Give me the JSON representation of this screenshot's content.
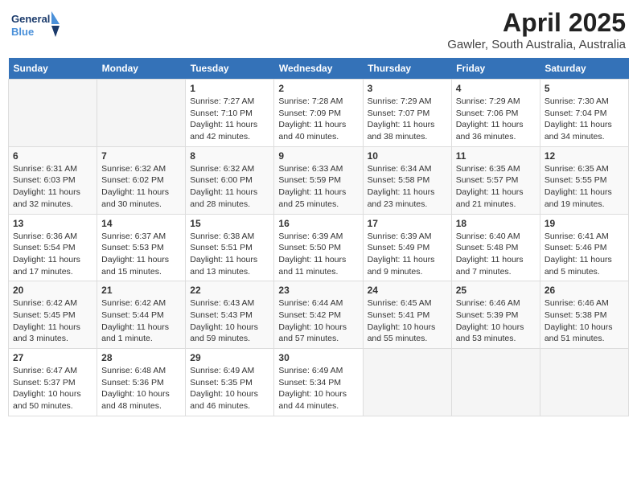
{
  "header": {
    "logo_general": "General",
    "logo_blue": "Blue",
    "month_title": "April 2025",
    "location": "Gawler, South Australia, Australia"
  },
  "days_of_week": [
    "Sunday",
    "Monday",
    "Tuesday",
    "Wednesday",
    "Thursday",
    "Friday",
    "Saturday"
  ],
  "weeks": [
    [
      {
        "day": "",
        "info": ""
      },
      {
        "day": "",
        "info": ""
      },
      {
        "day": "1",
        "info": "Sunrise: 7:27 AM\nSunset: 7:10 PM\nDaylight: 11 hours and 42 minutes."
      },
      {
        "day": "2",
        "info": "Sunrise: 7:28 AM\nSunset: 7:09 PM\nDaylight: 11 hours and 40 minutes."
      },
      {
        "day": "3",
        "info": "Sunrise: 7:29 AM\nSunset: 7:07 PM\nDaylight: 11 hours and 38 minutes."
      },
      {
        "day": "4",
        "info": "Sunrise: 7:29 AM\nSunset: 7:06 PM\nDaylight: 11 hours and 36 minutes."
      },
      {
        "day": "5",
        "info": "Sunrise: 7:30 AM\nSunset: 7:04 PM\nDaylight: 11 hours and 34 minutes."
      }
    ],
    [
      {
        "day": "6",
        "info": "Sunrise: 6:31 AM\nSunset: 6:03 PM\nDaylight: 11 hours and 32 minutes."
      },
      {
        "day": "7",
        "info": "Sunrise: 6:32 AM\nSunset: 6:02 PM\nDaylight: 11 hours and 30 minutes."
      },
      {
        "day": "8",
        "info": "Sunrise: 6:32 AM\nSunset: 6:00 PM\nDaylight: 11 hours and 28 minutes."
      },
      {
        "day": "9",
        "info": "Sunrise: 6:33 AM\nSunset: 5:59 PM\nDaylight: 11 hours and 25 minutes."
      },
      {
        "day": "10",
        "info": "Sunrise: 6:34 AM\nSunset: 5:58 PM\nDaylight: 11 hours and 23 minutes."
      },
      {
        "day": "11",
        "info": "Sunrise: 6:35 AM\nSunset: 5:57 PM\nDaylight: 11 hours and 21 minutes."
      },
      {
        "day": "12",
        "info": "Sunrise: 6:35 AM\nSunset: 5:55 PM\nDaylight: 11 hours and 19 minutes."
      }
    ],
    [
      {
        "day": "13",
        "info": "Sunrise: 6:36 AM\nSunset: 5:54 PM\nDaylight: 11 hours and 17 minutes."
      },
      {
        "day": "14",
        "info": "Sunrise: 6:37 AM\nSunset: 5:53 PM\nDaylight: 11 hours and 15 minutes."
      },
      {
        "day": "15",
        "info": "Sunrise: 6:38 AM\nSunset: 5:51 PM\nDaylight: 11 hours and 13 minutes."
      },
      {
        "day": "16",
        "info": "Sunrise: 6:39 AM\nSunset: 5:50 PM\nDaylight: 11 hours and 11 minutes."
      },
      {
        "day": "17",
        "info": "Sunrise: 6:39 AM\nSunset: 5:49 PM\nDaylight: 11 hours and 9 minutes."
      },
      {
        "day": "18",
        "info": "Sunrise: 6:40 AM\nSunset: 5:48 PM\nDaylight: 11 hours and 7 minutes."
      },
      {
        "day": "19",
        "info": "Sunrise: 6:41 AM\nSunset: 5:46 PM\nDaylight: 11 hours and 5 minutes."
      }
    ],
    [
      {
        "day": "20",
        "info": "Sunrise: 6:42 AM\nSunset: 5:45 PM\nDaylight: 11 hours and 3 minutes."
      },
      {
        "day": "21",
        "info": "Sunrise: 6:42 AM\nSunset: 5:44 PM\nDaylight: 11 hours and 1 minute."
      },
      {
        "day": "22",
        "info": "Sunrise: 6:43 AM\nSunset: 5:43 PM\nDaylight: 10 hours and 59 minutes."
      },
      {
        "day": "23",
        "info": "Sunrise: 6:44 AM\nSunset: 5:42 PM\nDaylight: 10 hours and 57 minutes."
      },
      {
        "day": "24",
        "info": "Sunrise: 6:45 AM\nSunset: 5:41 PM\nDaylight: 10 hours and 55 minutes."
      },
      {
        "day": "25",
        "info": "Sunrise: 6:46 AM\nSunset: 5:39 PM\nDaylight: 10 hours and 53 minutes."
      },
      {
        "day": "26",
        "info": "Sunrise: 6:46 AM\nSunset: 5:38 PM\nDaylight: 10 hours and 51 minutes."
      }
    ],
    [
      {
        "day": "27",
        "info": "Sunrise: 6:47 AM\nSunset: 5:37 PM\nDaylight: 10 hours and 50 minutes."
      },
      {
        "day": "28",
        "info": "Sunrise: 6:48 AM\nSunset: 5:36 PM\nDaylight: 10 hours and 48 minutes."
      },
      {
        "day": "29",
        "info": "Sunrise: 6:49 AM\nSunset: 5:35 PM\nDaylight: 10 hours and 46 minutes."
      },
      {
        "day": "30",
        "info": "Sunrise: 6:49 AM\nSunset: 5:34 PM\nDaylight: 10 hours and 44 minutes."
      },
      {
        "day": "",
        "info": ""
      },
      {
        "day": "",
        "info": ""
      },
      {
        "day": "",
        "info": ""
      }
    ]
  ]
}
